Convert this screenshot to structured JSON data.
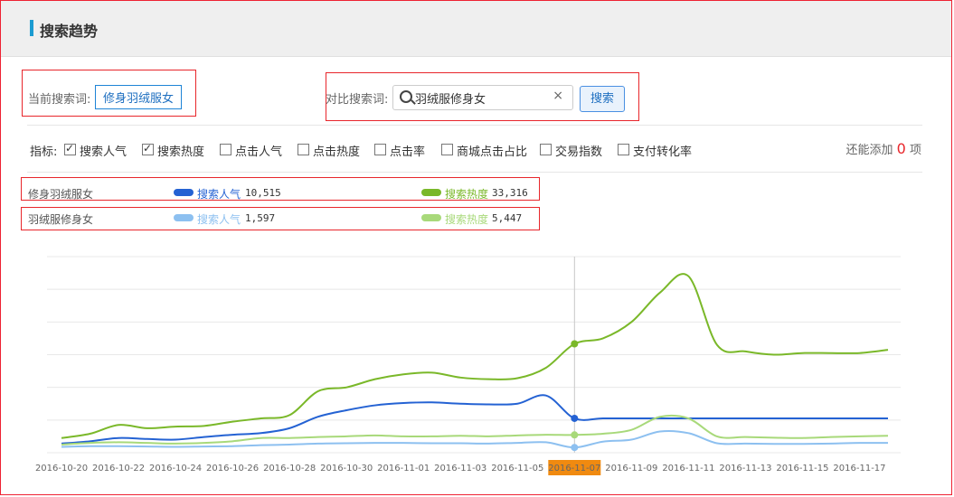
{
  "header": {
    "title": "搜索趋势"
  },
  "current": {
    "label": "当前搜索词:",
    "keyword": "修身羽绒服女"
  },
  "compare": {
    "label": "对比搜索词:",
    "value": "羽绒服修身女",
    "button": "搜索"
  },
  "metrics": {
    "label": "指标:",
    "items": [
      {
        "name": "搜索人气",
        "checked": true
      },
      {
        "name": "搜索热度",
        "checked": true
      },
      {
        "name": "点击人气",
        "checked": false
      },
      {
        "name": "点击热度",
        "checked": false
      },
      {
        "name": "点击率",
        "checked": false
      },
      {
        "name": "商城点击占比",
        "checked": false
      },
      {
        "name": "交易指数",
        "checked": false
      },
      {
        "name": "支付转化率",
        "checked": false
      }
    ],
    "remain_prefix": "还能添加",
    "remain_count": "0",
    "remain_suffix": "项"
  },
  "legend": [
    {
      "keyword": "修身羽绒服女",
      "s1_label": "搜索人气",
      "s1_value": "10,515",
      "s2_label": "搜索热度",
      "s2_value": "33,316"
    },
    {
      "keyword": "羽绒服修身女",
      "s1_label": "搜索人气",
      "s1_value": "1,597",
      "s2_label": "搜索热度",
      "s2_value": "5,447"
    }
  ],
  "colors": {
    "blue_dark": "#2462d3",
    "green_dark": "#7ab829",
    "blue_light": "#8dc0f0",
    "green_light": "#a8d97a",
    "highlight": "#f08a10"
  },
  "chart_data": {
    "type": "line",
    "x": [
      "2016-10-20",
      "2016-10-21",
      "2016-10-22",
      "2016-10-23",
      "2016-10-24",
      "2016-10-25",
      "2016-10-26",
      "2016-10-27",
      "2016-10-28",
      "2016-10-29",
      "2016-10-30",
      "2016-10-31",
      "2016-11-01",
      "2016-11-02",
      "2016-11-03",
      "2016-11-04",
      "2016-11-05",
      "2016-11-06",
      "2016-11-07",
      "2016-11-08",
      "2016-11-09",
      "2016-11-10",
      "2016-11-11",
      "2016-11-12",
      "2016-11-13",
      "2016-11-14",
      "2016-11-15",
      "2016-11-16",
      "2016-11-17",
      "2016-11-18"
    ],
    "tick_labels": [
      "2016-10-20",
      "2016-10-22",
      "2016-10-24",
      "2016-10-26",
      "2016-10-28",
      "2016-10-30",
      "2016-11-01",
      "2016-11-03",
      "2016-11-05",
      "2016-11-07",
      "2016-11-09",
      "2016-11-11",
      "2016-11-13",
      "2016-11-15",
      "2016-11-17"
    ],
    "highlight_x": "2016-11-07",
    "ylim": [
      0,
      60000
    ],
    "grid": true,
    "series": [
      {
        "name": "修身羽绒服女 搜索热度",
        "color": "#7ab829",
        "values": [
          4500,
          5800,
          8500,
          7500,
          8000,
          8200,
          9500,
          10500,
          11500,
          18800,
          20000,
          22500,
          24000,
          24500,
          23000,
          22500,
          22800,
          26000,
          33316,
          35000,
          40000,
          49000,
          54000,
          33000,
          31000,
          30000,
          30500,
          30500,
          30500,
          31500
        ]
      },
      {
        "name": "修身羽绒服女 搜索人气",
        "color": "#2462d3",
        "values": [
          2800,
          3500,
          4500,
          4200,
          4000,
          4800,
          5500,
          6000,
          7500,
          11000,
          13000,
          14500,
          15200,
          15400,
          15000,
          14800,
          15000,
          17500,
          10515,
          10515,
          10515,
          10515,
          10515,
          10515,
          10515,
          10515,
          10515,
          10515,
          10515,
          10515
        ]
      },
      {
        "name": "羽绒服修身女 搜索热度",
        "color": "#a8d97a",
        "values": [
          2500,
          3000,
          3200,
          3000,
          2800,
          3000,
          3500,
          4500,
          4500,
          4800,
          5000,
          5300,
          5000,
          5000,
          5200,
          5000,
          5300,
          5500,
          5447,
          5800,
          7000,
          11000,
          10500,
          5000,
          4800,
          4600,
          4500,
          4800,
          5000,
          5200
        ]
      },
      {
        "name": "羽绒服修身女 搜索人气",
        "color": "#8dc0f0",
        "values": [
          1800,
          2000,
          2000,
          1900,
          1800,
          1900,
          2000,
          2300,
          2500,
          2800,
          2900,
          3000,
          3000,
          2900,
          2900,
          2800,
          3000,
          3200,
          1597,
          3400,
          4000,
          6500,
          6000,
          2900,
          2800,
          2700,
          2700,
          2800,
          3000,
          3000
        ]
      }
    ]
  }
}
